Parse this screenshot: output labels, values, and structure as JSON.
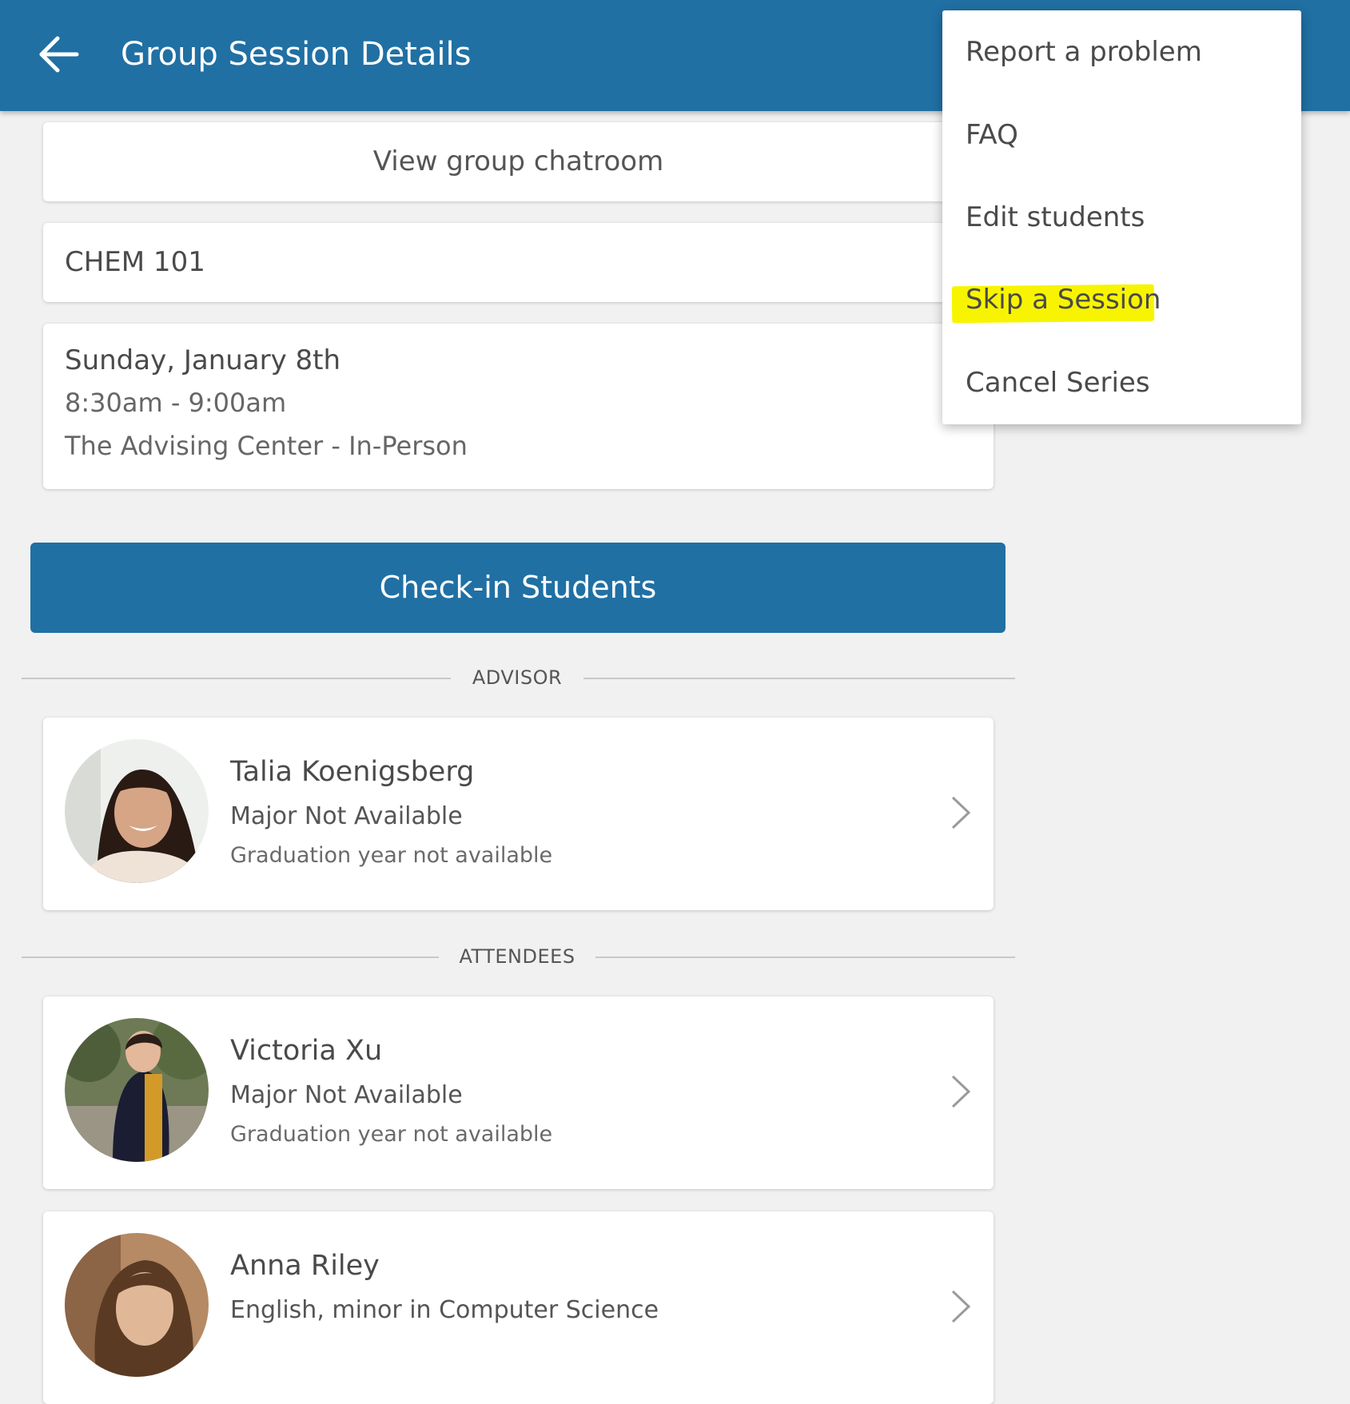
{
  "appbar": {
    "title": "Group Session Details",
    "back_icon": "arrow-left-icon",
    "background_color": "#2070a4"
  },
  "session": {
    "chatroom_label": "View group chatroom",
    "course": "CHEM 101",
    "day": "Sunday, January 8th",
    "time": "8:30am - 9:00am",
    "location": "The Advising Center - In-Person"
  },
  "checkin_button_label": "Check-in Students",
  "sections": {
    "advisor_label": "ADVISOR",
    "attendees_label": "ATTENDEES"
  },
  "advisor": {
    "name": "Talia Koenigsberg",
    "major": "Major Not Available",
    "graduation": "Graduation year not available"
  },
  "attendees": [
    {
      "name": "Victoria Xu",
      "major": "Major Not Available",
      "graduation": "Graduation year not available"
    },
    {
      "name": "Anna Riley",
      "major": "English, minor in Computer Science"
    }
  ],
  "overflow_menu": {
    "items": [
      {
        "label": "Report a problem"
      },
      {
        "label": "FAQ"
      },
      {
        "label": "Edit students"
      },
      {
        "label": "Skip a Session",
        "highlighted": true
      },
      {
        "label": "Cancel Series"
      }
    ],
    "highlight_color": "#f8f400"
  }
}
